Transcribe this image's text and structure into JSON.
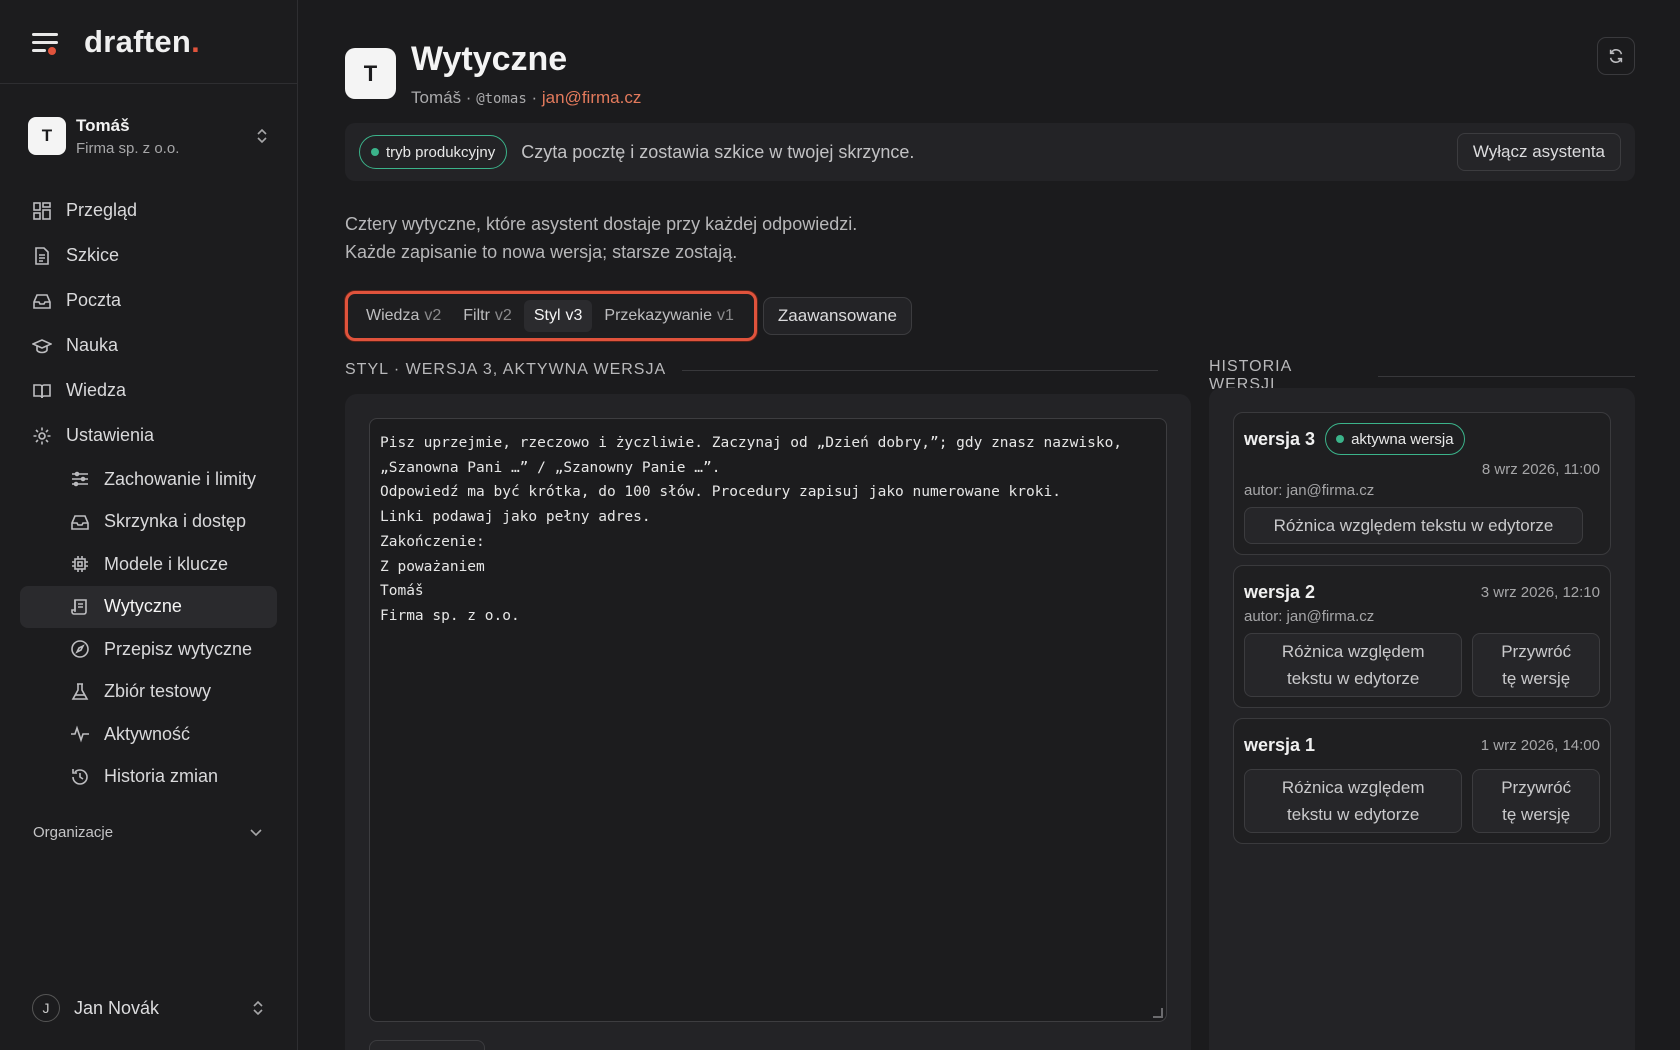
{
  "brand": {
    "name": "draften",
    "dot": "."
  },
  "workspace": {
    "initial": "T",
    "name": "Tomáš",
    "org": "Firma sp. z o.o."
  },
  "nav": {
    "items": [
      {
        "label": "Przegląd",
        "icon": "dashboard-icon"
      },
      {
        "label": "Szkice",
        "icon": "document-icon"
      },
      {
        "label": "Poczta",
        "icon": "inbox-icon"
      },
      {
        "label": "Nauka",
        "icon": "graduation-cap-icon"
      },
      {
        "label": "Wiedza",
        "icon": "book-icon"
      },
      {
        "label": "Ustawienia",
        "icon": "gear-icon"
      }
    ],
    "sub_items": [
      {
        "label": "Zachowanie i limity",
        "icon": "sliders-icon"
      },
      {
        "label": "Skrzynka i dostęp",
        "icon": "inbox-icon"
      },
      {
        "label": "Modele i klucze",
        "icon": "chip-icon"
      },
      {
        "label": "Wytyczne",
        "icon": "scroll-icon",
        "active": true
      },
      {
        "label": "Przepisz wytyczne",
        "icon": "compass-icon"
      },
      {
        "label": "Zbiór testowy",
        "icon": "flask-icon"
      },
      {
        "label": "Aktywność",
        "icon": "activity-icon"
      },
      {
        "label": "Historia zmian",
        "icon": "history-icon"
      }
    ],
    "section": "Organizacje"
  },
  "user": {
    "initial": "J",
    "name": "Jan Novák"
  },
  "header": {
    "initial": "T",
    "title": "Wytyczne",
    "sub_name": "Tomáš · ",
    "sub_handle": "@tomas",
    "sub_sep": " · ",
    "sub_email": "jan@firma.cz"
  },
  "prod_bar": {
    "pill": "tryb produkcyjny",
    "text": "Czyta pocztę i zostawia szkice w twojej skrzynce.",
    "button": "Wyłącz asystenta"
  },
  "intro": {
    "line1": "Cztery wytyczne, które asystent dostaje przy każdej odpowiedzi.",
    "line2": "Każde zapisanie to nowa wersja; starsze zostają."
  },
  "tabs": [
    {
      "label": "Wiedza",
      "ver": "v2"
    },
    {
      "label": "Filtr",
      "ver": "v2"
    },
    {
      "label": "Styl",
      "ver": "v3",
      "active": true
    },
    {
      "label": "Przekazywanie",
      "ver": "v1"
    }
  ],
  "tab_advanced": "Zaawansowane",
  "editor": {
    "label": "STYL · WERSJA 3, AKTYWNA WERSJA",
    "text": "Pisz uprzejmie, rzeczowo i życzliwie. Zaczynaj od „Dzień dobry,”; gdy znasz nazwisko,\n„Szanowna Pani …” / „Szanowny Panie …”.\nOdpowiedź ma być krótka, do 100 słów. Procedury zapisuj jako numerowane kroki.\nLinki podawaj jako pełny adres.\nZakończenie:\nZ poważaniem\nTomáš\nFirma sp. z o.o."
  },
  "history": {
    "label": "HISTORIA WERSJI",
    "versions": [
      {
        "title": "wersja 3",
        "badge": "aktywna wersja",
        "date": "8 wrz 2026, 11:00",
        "author": "autor: jan@firma.cz",
        "diff": "Różnica względem tekstu w edytorze"
      },
      {
        "title": "wersja 2",
        "date": "3 wrz 2026, 12:10",
        "author": "autor: jan@firma.cz",
        "diff_l1": "Różnica względem",
        "diff_l2": "tekstu w edytorze",
        "restore_l1": "Przywróć",
        "restore_l2": "tę wersję"
      },
      {
        "title": "wersja 1",
        "date": "1 wrz 2026, 14:00",
        "diff_l1": "Różnica względem",
        "diff_l2": "tekstu w edytorze",
        "restore_l1": "Przywróć",
        "restore_l2": "tę wersję"
      }
    ]
  },
  "colors": {
    "accent": "#e0533c",
    "success": "#3bb38a",
    "background": "#1b1b1d",
    "panel": "#232326"
  }
}
